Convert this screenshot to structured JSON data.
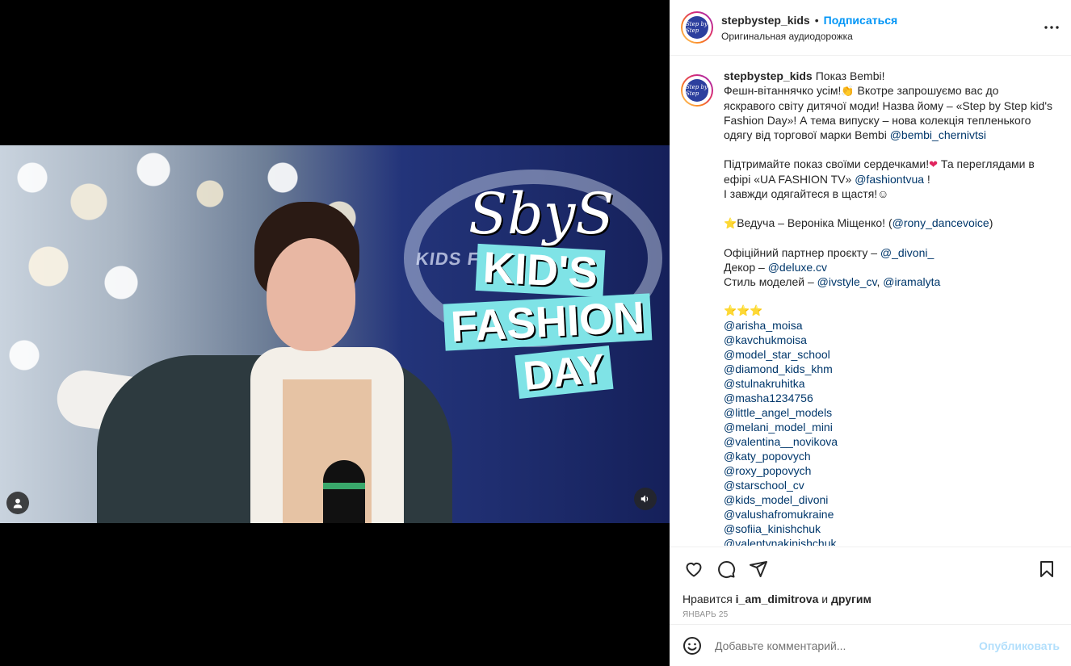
{
  "post": {
    "username": "stepbystep_kids",
    "separator": "•",
    "follow_label": "Подписаться",
    "audio_label": "Оригинальная аудиодорожка",
    "avatar_text": "Step by Step"
  },
  "video_overlay": {
    "stage_text": "KIDS FASHION DAY",
    "title_sbs": "SbyS",
    "title_line1": "KID'S",
    "title_line2": "FASHION",
    "title_line3": "DAY"
  },
  "caption": {
    "username": "stepbystep_kids",
    "l1": "Показ Bembi!",
    "l2a": "Фешн-вітаннячко усім!",
    "l2_emoji": "👏",
    "l2b": " Вкотре запрошуємо вас до",
    "l3": "яскравого світу дитячої моди! Назва йому – «Step by Step kid's",
    "l4": "Fashion Day»! А тема випуску – нова колекція тепленького",
    "l5": "одягу від торгової марки Bembi ",
    "l5_mention": "@bembi_chernivtsi",
    "l6a": "Підтримайте показ своїми сердечками!",
    "l6_emoji": "❤",
    "l6b": " Та переглядами в",
    "l7a": "ефірі «UA FASHION TV» ",
    "l7_mention": "@fashiontvua",
    "l7b": " !",
    "l8": "І завжди одягайтеся в щастя!☺",
    "l9_emoji": "⭐",
    "l9a": "Ведуча – Вероніка Міщенко! (",
    "l9_mention": "@rony_dancevoice",
    "l9b": ")",
    "l10a": "Офіційний партнер проєкту – ",
    "l10_mention": "@_divoni_",
    "l11a": "Декор – ",
    "l11_mention": "@deluxe.cv",
    "l12a": "Стиль моделей – ",
    "l12_mention1": "@ivstyle_cv",
    "l12_sep": ", ",
    "l12_mention2": "@iramalyta",
    "stars": "⭐⭐⭐",
    "mentions": [
      "@arisha_moisa",
      "@kavchukmoisa",
      "@model_star_school",
      "@diamond_kids_khm",
      "@stulnakruhitka",
      "@masha1234756",
      "@little_angel_models",
      "@melani_model_mini",
      "@valentina__novikova",
      "@katy_popovych",
      "@roxy_popovych",
      "@starschool_cv",
      "@kids_model_divoni",
      "@valushafromukraine",
      "@sofiia_kinishchuk",
      "@valentynakinishchuk"
    ]
  },
  "likes": {
    "prefix": "Нравится ",
    "user": "i_am_dimitrova",
    "middle": " и ",
    "others": "другим"
  },
  "date": "ЯНВАРЬ 25",
  "comment": {
    "placeholder": "Добавьте комментарий...",
    "publish": "Опубликовать"
  },
  "icons": {
    "like": "heart-icon",
    "comment": "comment-icon",
    "share": "share-icon",
    "save": "bookmark-icon",
    "emoji": "emoji-icon",
    "more": "more-icon",
    "user": "user-icon",
    "mute": "speaker-icon"
  },
  "colors": {
    "follow": "#0095f6",
    "mention": "#00376b",
    "publish_disabled": "#b2dffc",
    "overlay_band": "#7fe3e6"
  }
}
